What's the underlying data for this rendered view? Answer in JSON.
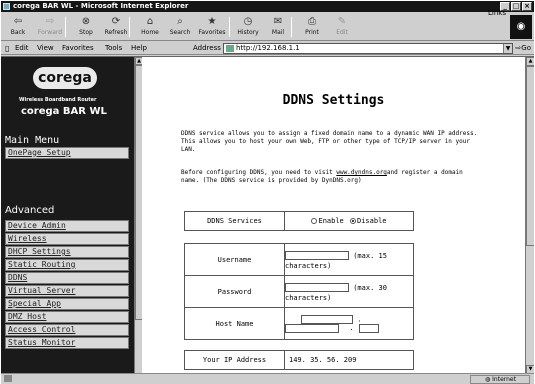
{
  "window": {
    "title": "corega BAR WL - Microsoft Internet Explorer",
    "buttons": [
      "_",
      "□",
      "×"
    ]
  },
  "toolbar": {
    "buttons": [
      {
        "label": "Back",
        "icon": "back-arrow-icon",
        "glyph": "⇦",
        "enabled": true
      },
      {
        "label": "Forward",
        "icon": "forward-arrow-icon",
        "glyph": "⇨",
        "enabled": false
      },
      {
        "label": "Stop",
        "icon": "stop-icon",
        "glyph": "⊗",
        "enabled": true
      },
      {
        "label": "Refresh",
        "icon": "refresh-icon",
        "glyph": "⟳",
        "enabled": true
      },
      {
        "label": "Home",
        "icon": "home-icon",
        "glyph": "⌂",
        "enabled": true
      },
      {
        "label": "Search",
        "icon": "search-icon",
        "glyph": "⌕",
        "enabled": true
      },
      {
        "label": "Favorites",
        "icon": "favorites-icon",
        "glyph": "★",
        "enabled": true
      },
      {
        "label": "History",
        "icon": "history-icon",
        "glyph": "◷",
        "enabled": true
      },
      {
        "label": "Mail",
        "icon": "mail-icon",
        "glyph": "✉",
        "enabled": true
      },
      {
        "label": "Print",
        "icon": "print-icon",
        "glyph": "⎙",
        "enabled": true
      },
      {
        "label": "Edit",
        "icon": "edit-icon",
        "glyph": "✎",
        "enabled": false
      }
    ],
    "links_label": "Links"
  },
  "menubar": {
    "items": [
      "Edit",
      "View",
      "Favorites",
      "Tools",
      "Help"
    ],
    "address_label": "Address",
    "address": "http://192.168.1.1",
    "go_label": "Go"
  },
  "sidebar": {
    "logo": "corega",
    "subtitle": "Wireless Boardband Router",
    "model": "corega BAR WL",
    "main_menu_title": "Main Menu",
    "onepage": "OnePage Setup",
    "advanced_title": "Advanced",
    "items": [
      "Device Admin",
      "Wireless",
      "DHCP Settings",
      "Static Routing",
      "DDNS",
      "Virtual Server",
      "Special App",
      "DMZ Host",
      "Access Control",
      "Status Monitor"
    ]
  },
  "main": {
    "title": "DDNS Settings",
    "intro": "DDNS service allows you to assign a fixed domain name to a dynamic WAN IP address. This allows you to host your own Web, FTP or other type of TCP/IP server in your LAN.",
    "before_text": "Before configuring DDNS, you need to visit ",
    "link_text": "www.dyndns.org",
    "after_text": "and register a domain name. (The DDNS service is provided by DynDNS.org)",
    "ddns_services_label": "DDNS Services",
    "enable_label": "Enable",
    "disable_label": "Disable",
    "username_label": "Username",
    "username_hint": "(max. 15 characters)",
    "password_label": "Password",
    "password_hint": "(max. 30 characters)",
    "hostname_label": "Host Name",
    "dot": ".",
    "your_ip_label": "Your IP Address",
    "your_ip_value": "149. 35. 56. 209"
  },
  "status": {
    "zone": "Internet"
  }
}
